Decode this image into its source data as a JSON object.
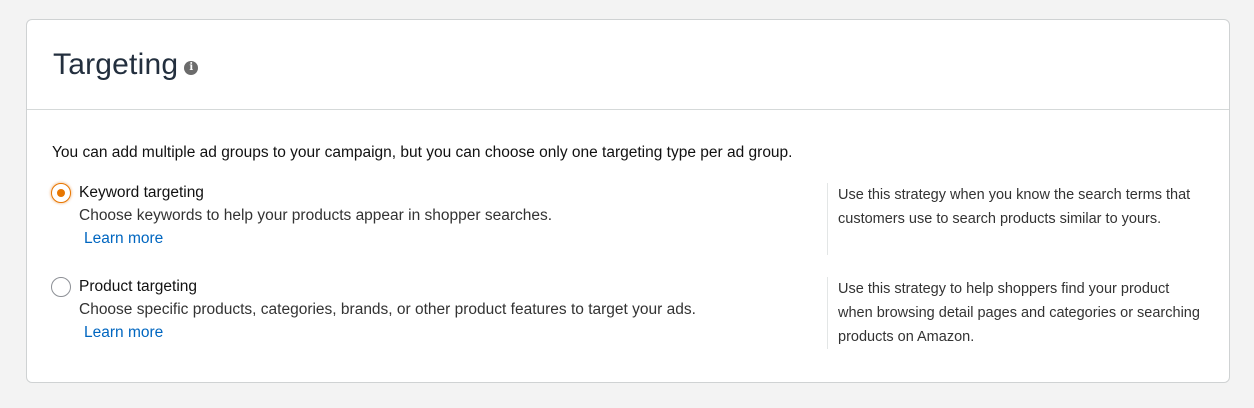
{
  "card": {
    "title": "Targeting",
    "info_icon": "info-icon"
  },
  "intro": "You can add multiple ad groups to your campaign, but you can choose only one targeting type per ad group.",
  "options": [
    {
      "label": "Keyword targeting",
      "description": "Choose keywords to help your products appear in shopper searches.",
      "link": "Learn more",
      "hint": "Use this strategy when you know the search terms that customers use to search products similar to yours.",
      "selected": true
    },
    {
      "label": "Product targeting",
      "description": "Choose specific products, categories, brands, or other product features to target your ads.",
      "link": "Learn more",
      "hint": "Use this strategy to help shoppers find your product when browsing detail pages and categories or searching products on Amazon.",
      "selected": false
    }
  ],
  "colors": {
    "accent": "#e77600",
    "link": "#0066c0"
  }
}
